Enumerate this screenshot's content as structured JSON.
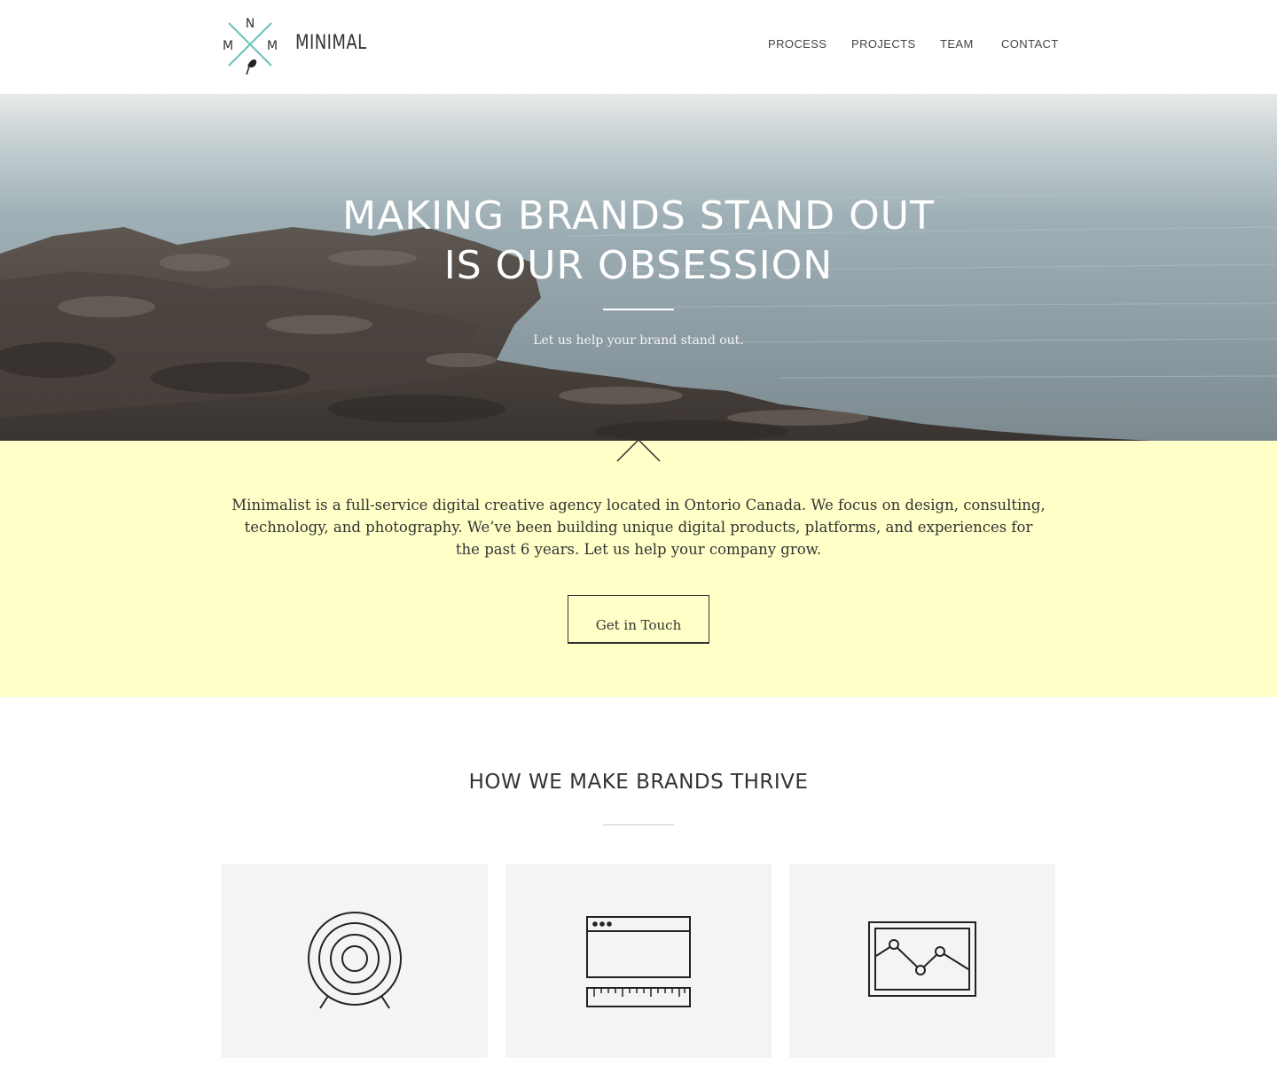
{
  "header": {
    "logo_letters": {
      "top": "N",
      "left": "M",
      "right": "M"
    },
    "brand_name": "MINIMAL",
    "nav": [
      {
        "label": "PROCESS"
      },
      {
        "label": "PROJECTS"
      },
      {
        "label": "TEAM"
      },
      {
        "label": "CONTACT"
      }
    ],
    "logo_accent": "#6cc4bc"
  },
  "hero": {
    "title_line1": "MAKING BRANDS STAND OUT",
    "title_line2": "IS OUR OBSESSION",
    "subtitle": "Let us help your brand stand out."
  },
  "intro": {
    "text": "Minimalist is a full-service digital creative agency located in Ontorio Canada. We focus on design, consulting, technology, and photography. We’ve been building unique digital products, platforms, and experiences for the past 6 years. Let us help your company grow.",
    "cta_label": "Get in Touch",
    "background": "#ffffc8"
  },
  "services": {
    "title": "HOW WE MAKE BRANDS THRIVE",
    "cards": [
      {
        "icon": "target-icon"
      },
      {
        "icon": "browser-ruler-icon"
      },
      {
        "icon": "line-chart-frame-icon"
      }
    ]
  }
}
